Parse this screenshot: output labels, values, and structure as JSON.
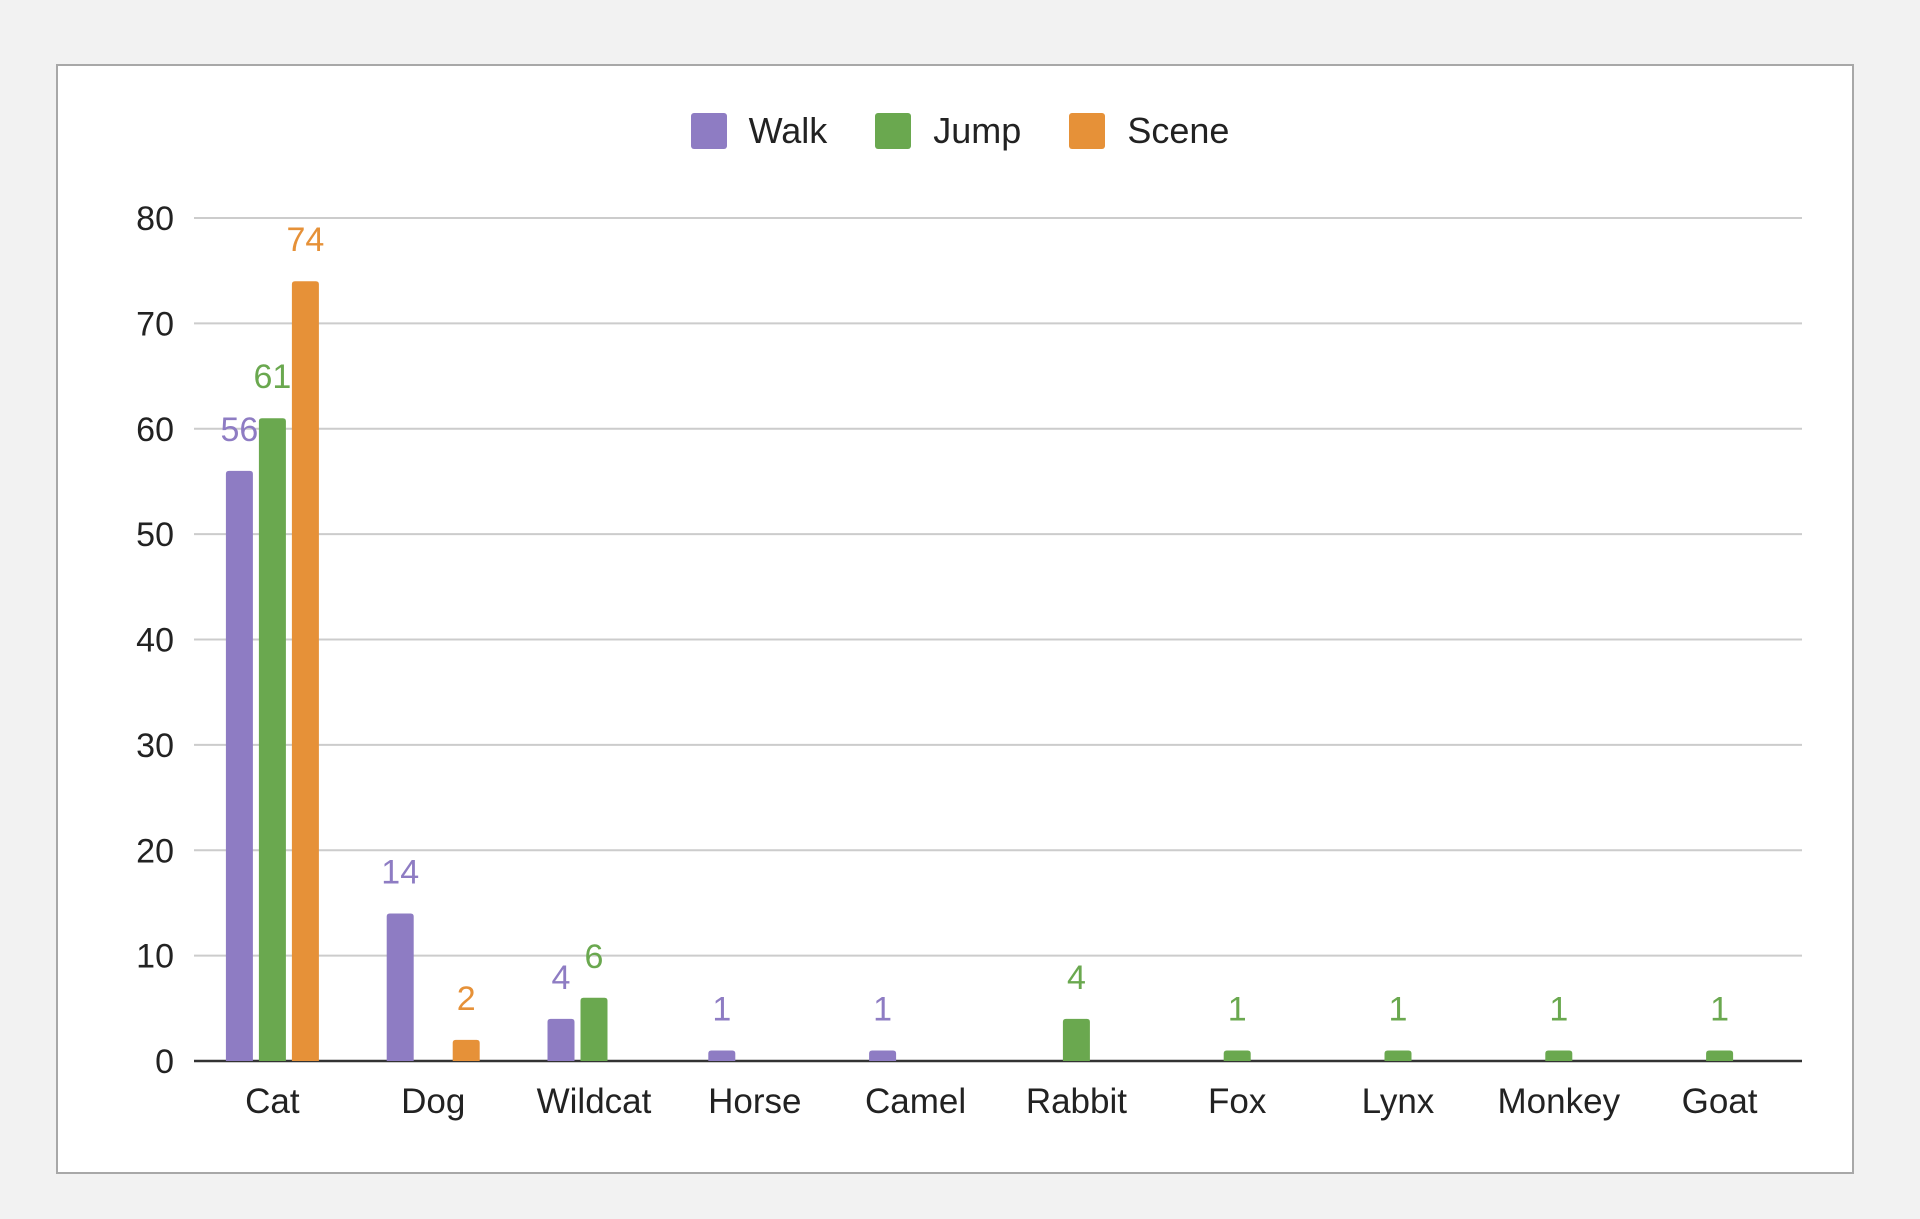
{
  "chart_data": {
    "type": "bar",
    "categories": [
      "Cat",
      "Dog",
      "Wildcat",
      "Horse",
      "Camel",
      "Rabbit",
      "Fox",
      "Lynx",
      "Monkey",
      "Goat"
    ],
    "series": [
      {
        "name": "Walk",
        "color": "#8e7cc3",
        "values": [
          56,
          14,
          4,
          1,
          1,
          null,
          null,
          null,
          null,
          null
        ]
      },
      {
        "name": "Jump",
        "color": "#6aa84f",
        "values": [
          61,
          null,
          6,
          null,
          null,
          4,
          1,
          1,
          1,
          1
        ]
      },
      {
        "name": "Scene",
        "color": "#e69138",
        "values": [
          74,
          2,
          null,
          null,
          null,
          null,
          null,
          null,
          null,
          null
        ]
      }
    ],
    "ylim": [
      0,
      80
    ],
    "yticks": [
      0,
      10,
      20,
      30,
      40,
      50,
      60,
      70,
      80
    ],
    "grid": true,
    "legend_position": "top",
    "data_labels": true
  }
}
